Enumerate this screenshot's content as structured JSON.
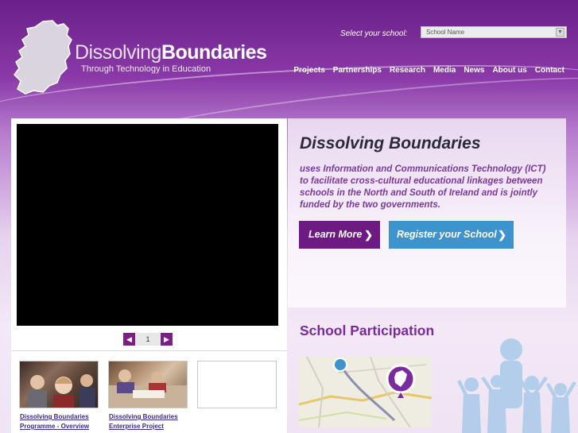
{
  "brand": {
    "name_light": "Dissolving",
    "name_bold": "Boundaries",
    "tagline": "Through Technology in Education"
  },
  "school_selector": {
    "label": "Select your school:",
    "value": "School Name"
  },
  "nav": {
    "items": [
      "Projects",
      "Partnerships",
      "Research",
      "Media",
      "News",
      "About us",
      "Contact"
    ]
  },
  "pager": {
    "prev_icon": "chevron-left-icon",
    "current": "1",
    "next_icon": "chevron-right-icon"
  },
  "videos": [
    {
      "line1": "Dissolving Boundaries",
      "line2": "Programme - Overview"
    },
    {
      "line1": "Dissolving Boundaries",
      "line2": "Enterprise Project"
    }
  ],
  "intro": {
    "title": "Dissolving Boundaries",
    "text": "uses Information and Communications Technology (ICT) to facilitate cross-cultural educational linkages between schools in the North and South of Ireland and is jointly funded by the two governments.",
    "learn_more": "Learn More",
    "register": "Register your School"
  },
  "participation": {
    "title": "School Participation"
  },
  "colors": {
    "purple_dark": "#6d1a83",
    "purple_text": "#7a3a9e",
    "blue_button": "#3e93cc",
    "link": "#3a2a8a"
  }
}
